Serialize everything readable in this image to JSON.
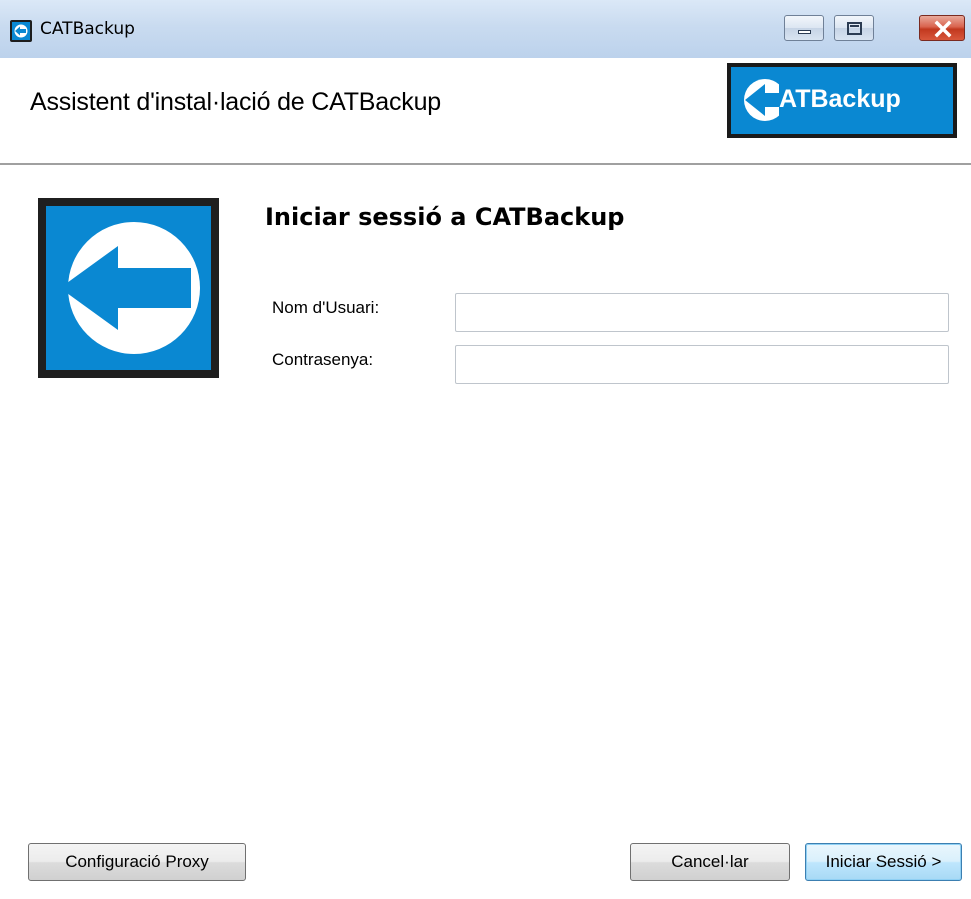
{
  "window": {
    "title": "CATBackup"
  },
  "header": {
    "heading": "Assistent d'instal·lació de CATBackup",
    "logo_text": "ATBackup",
    "brand_color": "#0a88d2"
  },
  "login": {
    "title": "Iniciar sessió a CATBackup",
    "username_label": "Nom d'Usuari:",
    "username_value": "",
    "password_label": "Contrasenya:",
    "password_value": ""
  },
  "buttons": {
    "proxy": "Configuració Proxy",
    "cancel": "Cancel·lar",
    "login": "Iniciar Sessió >"
  },
  "icons": {
    "app": "catbackup-app-icon",
    "minimize": "minimize-icon",
    "maximize": "maximize-icon",
    "close": "close-icon"
  }
}
